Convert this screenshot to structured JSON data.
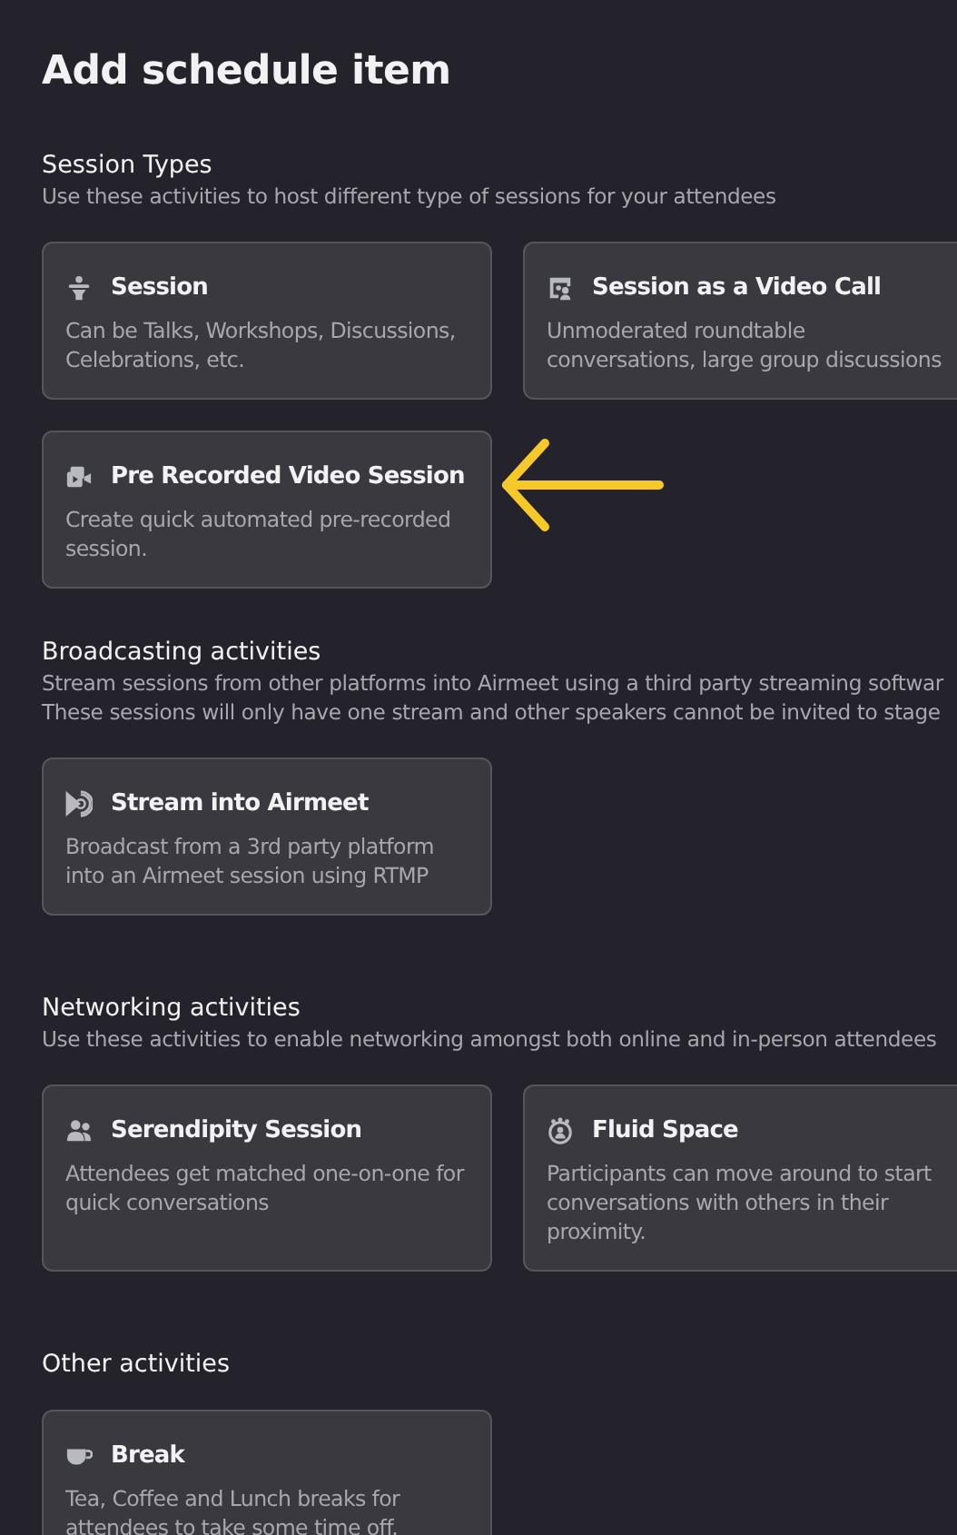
{
  "title": "Add schedule item",
  "sections": [
    {
      "heading": "Session Types",
      "description": [
        "Use these activities to host different type of sessions for your attendees"
      ],
      "cards": [
        {
          "kind": "speaker",
          "title": "Session",
          "description": "Can be Talks, Workshops, Discussions, Celebrations, etc.",
          "pointed": false
        },
        {
          "kind": "videocall",
          "title": "Session as a Video Call",
          "description": "Unmoderated roundtable conversations, large group discussions",
          "pointed": false
        },
        {
          "kind": "recorded",
          "title": "Pre Recorded Video Session",
          "description": "Create quick automated pre-recorded session.",
          "pointed": true
        }
      ]
    },
    {
      "heading": "Broadcasting activities",
      "description": [
        "Stream sessions from other platforms into Airmeet using a third party streaming softwar",
        "These sessions will only have one stream and other speakers cannot be invited to stage"
      ],
      "cards": [
        {
          "kind": "stream",
          "title": "Stream into Airmeet",
          "description": "Broadcast from a 3rd party platform into an Airmeet session using RTMP",
          "pointed": false
        }
      ]
    },
    {
      "heading": "Networking activities",
      "description": [
        "Use these activities to enable networking amongst both online and in-person attendees"
      ],
      "cards": [
        {
          "kind": "people",
          "title": "Serendipity Session",
          "description": "Attendees get matched one-on-one for quick conversations",
          "pointed": false
        },
        {
          "kind": "fluid",
          "title": "Fluid Space",
          "description": "Participants can move around to start conversations with others in their proximity.",
          "pointed": false
        }
      ]
    },
    {
      "heading": "Other activities",
      "cards": [
        {
          "kind": "cup",
          "title": "Break",
          "description": "Tea, Coffee and Lunch breaks for attendees to take some time off.",
          "pointed": false
        }
      ]
    }
  ]
}
